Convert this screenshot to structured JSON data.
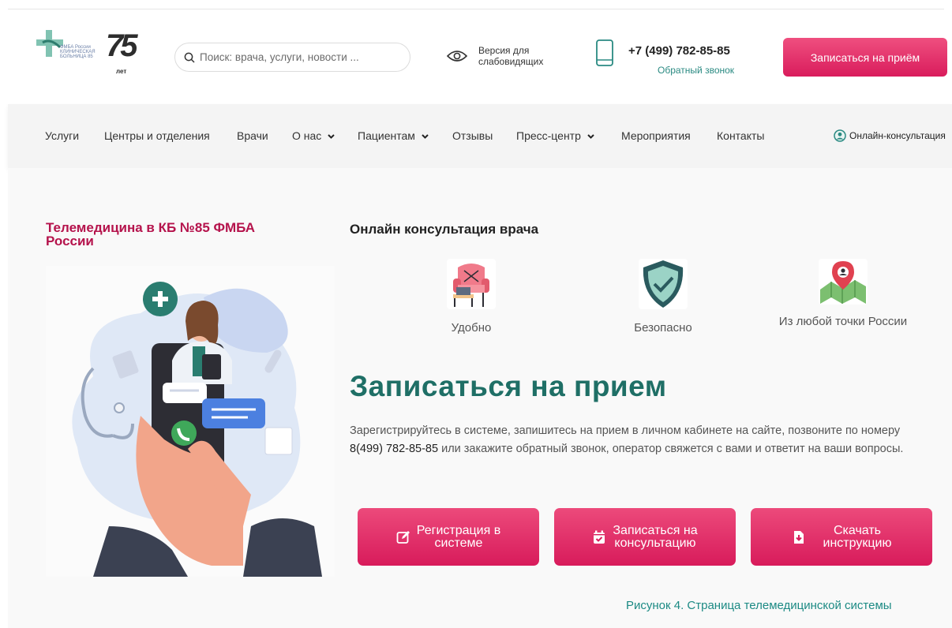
{
  "header": {
    "logo_small_text": "ФМБА России КЛИНИЧЕСКАЯ БОЛЬНИЦА 85",
    "logo_years": "75",
    "logo_years_word": "лет",
    "search_placeholder": "Поиск: врача, услуги, новости ...",
    "low_vision_label": "Версия для слабовидящих",
    "phone": "+7 (499) 782-85-85",
    "callback_label": "Обратный звонок",
    "book_button": "Записаться на приём"
  },
  "nav": {
    "items": [
      {
        "label": "Услуги"
      },
      {
        "label": "Центры и отделения"
      },
      {
        "label": "Врачи"
      },
      {
        "label": "О нас"
      },
      {
        "label": "Пациентам"
      },
      {
        "label": "Отзывы"
      },
      {
        "label": "Пресс-центр"
      },
      {
        "label": "Мероприятия"
      },
      {
        "label": "Контакты"
      }
    ],
    "online_consult": "Онлайн-консультация"
  },
  "main": {
    "side_title": "Телемедицина в КБ №85 ФМБА России",
    "consult_title": "Онлайн консультация врача",
    "features": [
      {
        "label": "Удобно",
        "icon": "armchair-laptop-icon"
      },
      {
        "label": "Безопасно",
        "icon": "shield-check-icon"
      },
      {
        "label": "Из любой точки России",
        "icon": "map-pin-icon"
      }
    ],
    "big_title": "Записаться на прием",
    "desc_before": "Зарегистрируйтесь в системе, запишитесь на прием в личном кабинете на сайте, позвоните по номеру ",
    "desc_phone": "8(499) 782-85-85",
    "desc_after": "  или закажите обратный звонок, оператор свяжется с вами и ответит на ваши вопросы.",
    "buttons": [
      {
        "label": "Регистрация в\nсистеме",
        "icon": "edit-icon"
      },
      {
        "label": "Записаться на\nконсультацию",
        "icon": "calendar-check-icon"
      },
      {
        "label": "Скачать\nинструкцию",
        "icon": "file-download-icon"
      }
    ]
  },
  "caption": "Рисунок 4. Страница телемедицинской системы",
  "colors": {
    "accent_pink": "#d91c5c",
    "brand_green": "#1f6f66",
    "title_crimson": "#b5134c",
    "link_teal": "#2a8a82"
  }
}
